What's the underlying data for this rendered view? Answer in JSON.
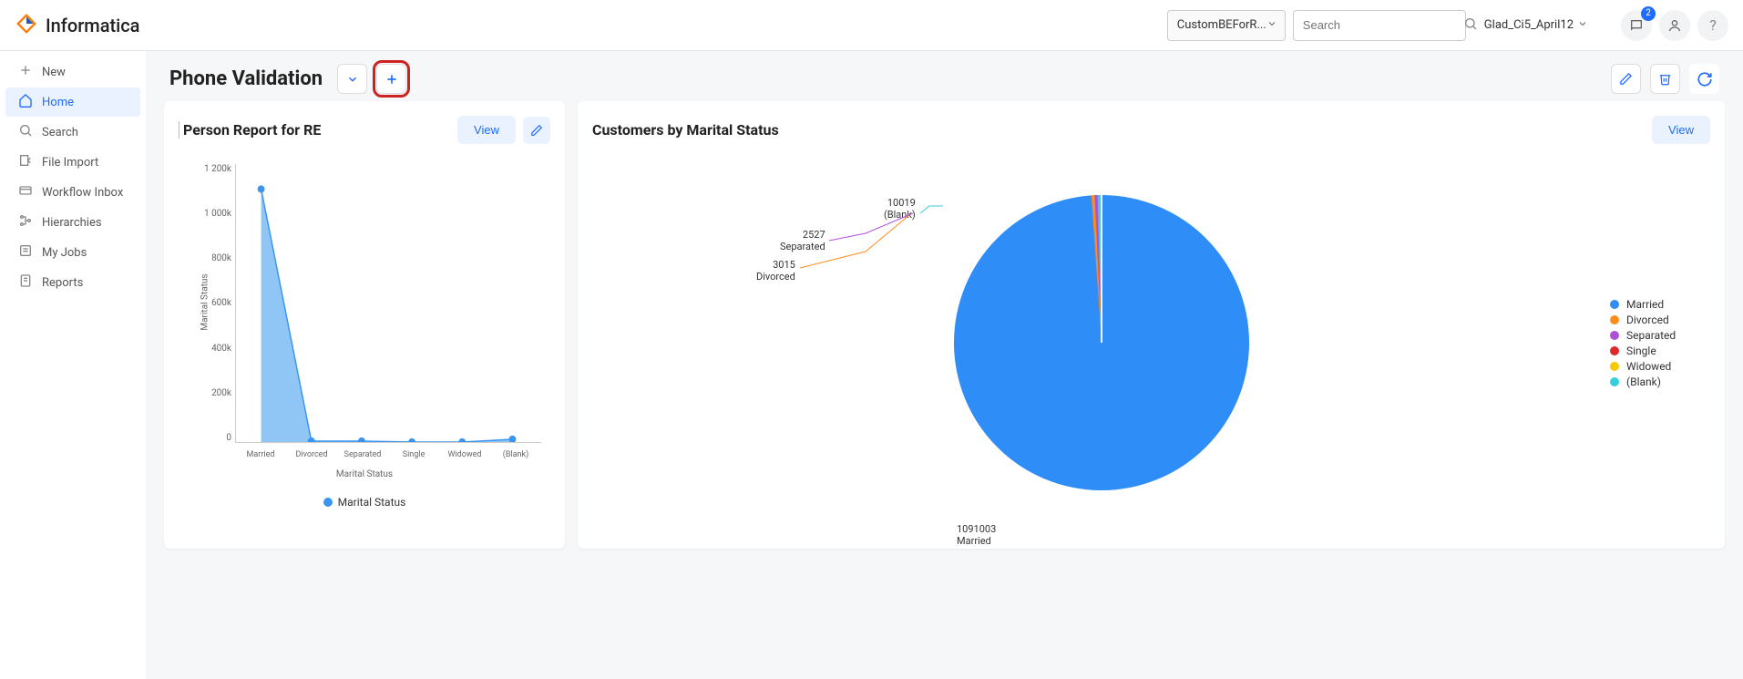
{
  "header": {
    "brand": "Informatica",
    "dropdown_label": "CustomBEForR...",
    "search_placeholder": "Search",
    "user_label": "Glad_Ci5_April12",
    "notification_count": "2"
  },
  "sidebar": {
    "items": [
      {
        "label": "New"
      },
      {
        "label": "Home"
      },
      {
        "label": "Search"
      },
      {
        "label": "File Import"
      },
      {
        "label": "Workflow Inbox"
      },
      {
        "label": "Hierarchies"
      },
      {
        "label": "My Jobs"
      },
      {
        "label": "Reports"
      }
    ]
  },
  "page": {
    "title": "Phone Validation"
  },
  "card_left": {
    "title": "Person Report for RE",
    "view_label": "View",
    "legend": "Marital Status",
    "y_ticks": [
      "1 200k",
      "1 000k",
      "800k",
      "600k",
      "400k",
      "200k",
      "0"
    ],
    "x_ticks": [
      "Married",
      "Divorced",
      "Separated",
      "Single",
      "Widowed",
      "(Blank)"
    ],
    "y_axis_label": "Marital Status",
    "x_axis_label": "Marital Status"
  },
  "card_right": {
    "title": "Customers by Marital Status",
    "view_label": "View",
    "legend": [
      {
        "label": "Married",
        "color": "#2e8df7"
      },
      {
        "label": "Divorced",
        "color": "#ff8c1a"
      },
      {
        "label": "Separated",
        "color": "#b04fd9"
      },
      {
        "label": "Single",
        "color": "#e02828"
      },
      {
        "label": "Widowed",
        "color": "#f5c900"
      },
      {
        "label": "(Blank)",
        "color": "#35d0dc"
      }
    ],
    "labels": {
      "married": "1091003\nMarried",
      "blank": "10019\n(Blank)",
      "separated": "2527\nSeparated",
      "divorced": "3015\nDivorced"
    }
  },
  "chart_data": [
    {
      "type": "area",
      "title": "Person Report for RE",
      "xlabel": "Marital Status",
      "ylabel": "Marital Status",
      "ylim": [
        0,
        1200000
      ],
      "categories": [
        "Married",
        "Divorced",
        "Separated",
        "Single",
        "Widowed",
        "(Blank)"
      ],
      "series": [
        {
          "name": "Marital Status",
          "values": [
            1091003,
            3015,
            2527,
            0,
            0,
            10019
          ]
        }
      ]
    },
    {
      "type": "pie",
      "title": "Customers by Marital Status",
      "series": [
        {
          "name": "Married",
          "value": 1091003,
          "color": "#2e8df7"
        },
        {
          "name": "Divorced",
          "value": 3015,
          "color": "#ff8c1a"
        },
        {
          "name": "Separated",
          "value": 2527,
          "color": "#b04fd9"
        },
        {
          "name": "Single",
          "value": 0,
          "color": "#e02828"
        },
        {
          "name": "Widowed",
          "value": 0,
          "color": "#f5c900"
        },
        {
          "name": "(Blank)",
          "value": 10019,
          "color": "#35d0dc"
        }
      ]
    }
  ]
}
